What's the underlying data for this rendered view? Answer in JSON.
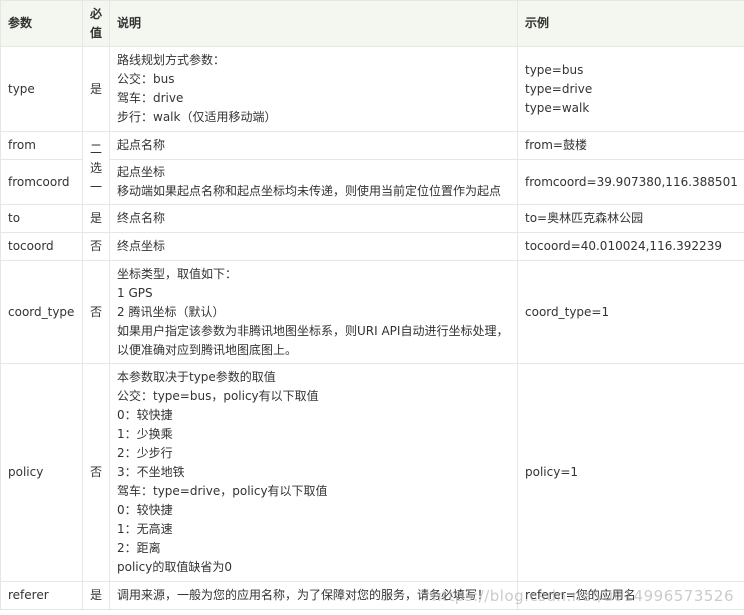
{
  "headers": [
    "参数",
    "必值",
    "说明",
    "示例"
  ],
  "header_req_lines": [
    "必",
    "值"
  ],
  "rows": {
    "type": {
      "param": "type",
      "required": "是",
      "desc": [
        "路线规划方式参数：",
        "公交：bus",
        "驾车：drive",
        "步行：walk（仅适用移动端）"
      ],
      "example": [
        "type=bus",
        "type=drive",
        "type=walk"
      ]
    },
    "from": {
      "param": "from",
      "desc": [
        "起点名称"
      ],
      "example": [
        "from=鼓楼"
      ]
    },
    "fromcoord": {
      "param": "fromcoord",
      "desc": [
        "起点坐标",
        "移动端如果起点名称和起点坐标均未传递，则使用当前定位位置作为起点"
      ],
      "example": [
        "fromcoord=39.907380,116.388501"
      ]
    },
    "from_group_required": [
      "二",
      "选",
      "一"
    ],
    "to": {
      "param": "to",
      "required": "是",
      "desc": [
        "终点名称"
      ],
      "example": [
        "to=奥林匹克森林公园"
      ]
    },
    "tocoord": {
      "param": "tocoord",
      "required": "否",
      "desc": [
        "终点坐标"
      ],
      "example": [
        "tocoord=40.010024,116.392239"
      ]
    },
    "coord_type": {
      "param": "coord_type",
      "required": "否",
      "desc": [
        "坐标类型，取值如下：",
        "1 GPS",
        "2 腾讯坐标（默认）",
        "如果用户指定该参数为非腾讯地图坐标系，则URI API自动进行坐标处理，以便准确对应到腾讯地图底图上。"
      ],
      "example": [
        "coord_type=1"
      ]
    },
    "policy": {
      "param": "policy",
      "required": "否",
      "desc": [
        "本参数取决于type参数的取值",
        "公交：type=bus，policy有以下取值",
        "0：较快捷",
        "1：少换乘",
        "2：少步行",
        "3：不坐地铁",
        "驾车：type=drive，policy有以下取值",
        "0：较快捷",
        "1：无高速",
        "2：距离",
        "policy的取值缺省为0"
      ],
      "example": [
        "policy=1"
      ]
    },
    "referer": {
      "param": "referer",
      "required": "是",
      "desc": [
        "调用来源，一般为您的应用名称，为了保障对您的服务，请务必填写！"
      ],
      "example": [
        "referer=您的应用名"
      ]
    }
  },
  "watermark": "https://blog.csdn.net/u014996573526",
  "colors": {
    "header_bg": "#f4f6f0",
    "border": "#e6e6e6",
    "text": "#333333"
  }
}
